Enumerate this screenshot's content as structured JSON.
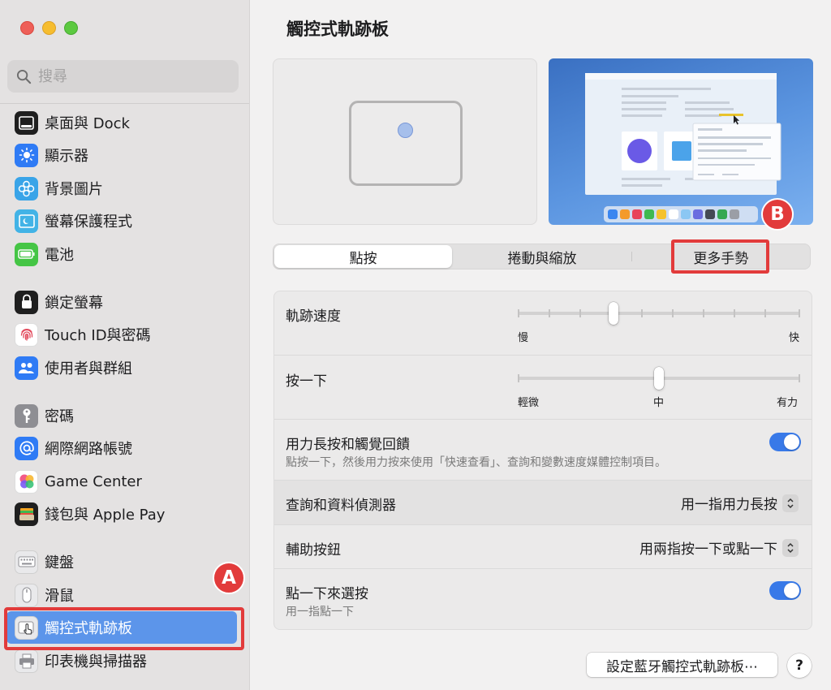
{
  "window": {
    "title": "觸控式軌跡板"
  },
  "search": {
    "placeholder": "搜尋"
  },
  "sidebar": {
    "items": [
      {
        "label": "桌面與 Dock",
        "icon": "dock-icon"
      },
      {
        "label": "顯示器",
        "icon": "display-icon"
      },
      {
        "label": "背景圖片",
        "icon": "wallpaper-icon"
      },
      {
        "label": "螢幕保護程式",
        "icon": "screensaver-icon"
      },
      {
        "label": "電池",
        "icon": "battery-icon"
      },
      {
        "label": "鎖定螢幕",
        "icon": "lock-icon"
      },
      {
        "label": "Touch ID與密碼",
        "icon": "fingerprint-icon"
      },
      {
        "label": "使用者與群組",
        "icon": "users-icon"
      },
      {
        "label": "密碼",
        "icon": "key-icon"
      },
      {
        "label": "網際網路帳號",
        "icon": "at-sign-icon"
      },
      {
        "label": "Game Center",
        "icon": "game-center-icon"
      },
      {
        "label": "錢包與 Apple Pay",
        "icon": "wallet-icon"
      },
      {
        "label": "鍵盤",
        "icon": "keyboard-icon"
      },
      {
        "label": "滑鼠",
        "icon": "mouse-icon"
      },
      {
        "label": "觸控式軌跡板",
        "icon": "trackpad-icon",
        "selected": true
      },
      {
        "label": "印表機與掃描器",
        "icon": "printer-icon"
      }
    ]
  },
  "annotations": {
    "a": "A",
    "b": "B"
  },
  "tabs": [
    {
      "label": "點按",
      "active": true
    },
    {
      "label": "捲動與縮放",
      "active": false
    },
    {
      "label": "更多手勢",
      "active": false
    }
  ],
  "settings": {
    "tracking_speed": {
      "label": "軌跡速度",
      "min_label": "慢",
      "max_label": "快",
      "value": 0.33,
      "ticks": 10
    },
    "click": {
      "label": "按一下",
      "min_label": "輕微",
      "mid_label": "中",
      "max_label": "有力",
      "value": 0.5,
      "ticks": 3
    },
    "force_click": {
      "label": "用力長按和觸覺回饋",
      "description": "點按一下，然後用力按來使用「快速查看」、查詢和變數速度媒體控制項目。",
      "enabled": true
    },
    "lookup": {
      "label": "查詢和資料偵測器",
      "value": "用一指用力長按"
    },
    "secondary_click": {
      "label": "輔助按鈕",
      "value": "用兩指按一下或點一下"
    },
    "tap_to_click": {
      "label": "點一下來選按",
      "description": "用一指點一下",
      "enabled": true
    }
  },
  "footer": {
    "bluetooth_button": "設定藍牙觸控式軌跡板⋯",
    "help_button": "?"
  },
  "colors": {
    "accent": "#3879e8",
    "selection": "#5c95ea",
    "annotation_red": "#e23b3b"
  }
}
